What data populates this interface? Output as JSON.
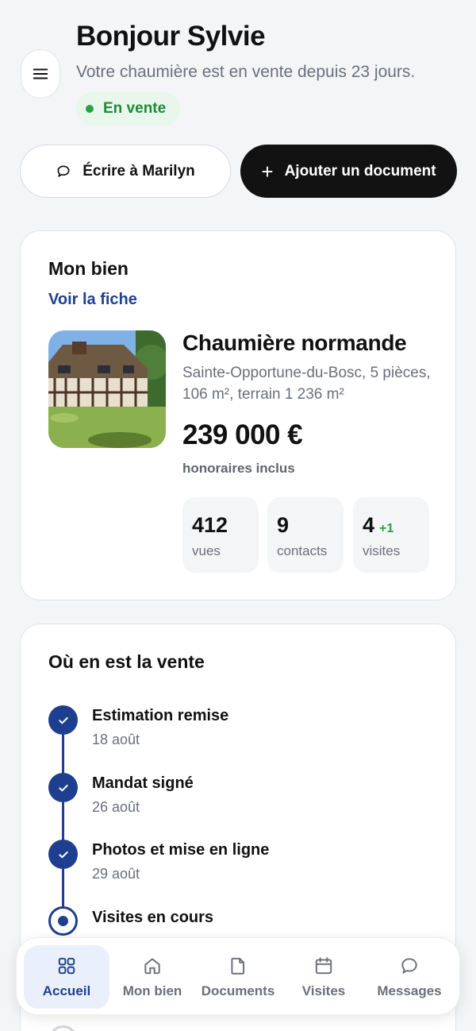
{
  "header": {
    "title": "Bonjour Sylvie",
    "subtitle": "Votre chaumière est en vente depuis 23 jours.",
    "status": "En vente",
    "status_color": "#22a447"
  },
  "actions": {
    "write_label": "Écrire à Marilyn",
    "add_label": "Ajouter un document"
  },
  "property": {
    "section_title": "Mon bien",
    "link": "Voir la fiche",
    "name": "Chaumière normande",
    "description": "Sainte-Opportune-du-Bosc, 5 pièces, 106 m², terrain 1 236 m²",
    "price": "239 000 €",
    "fee_note": "honoraires inclus",
    "stats": [
      {
        "value": "412",
        "label": "vues",
        "delta": ""
      },
      {
        "value": "9",
        "label": "contacts",
        "delta": ""
      },
      {
        "value": "4",
        "label": "visites",
        "delta": "+1"
      }
    ]
  },
  "progress": {
    "section_title": "Où en est la vente",
    "steps": [
      {
        "label": "Estimation remise",
        "date": "18 août",
        "state": "done"
      },
      {
        "label": "Mandat signé",
        "date": "26 août",
        "state": "done"
      },
      {
        "label": "Photos et mise en ligne",
        "date": "29 août",
        "state": "done"
      },
      {
        "label": "Visites en cours",
        "date": "",
        "state": "current"
      }
    ]
  },
  "tabbar": {
    "items": [
      {
        "label": "Accueil",
        "icon": "grid-icon",
        "active": true
      },
      {
        "label": "Mon bien",
        "icon": "home-icon",
        "active": false
      },
      {
        "label": "Documents",
        "icon": "document-icon",
        "active": false
      },
      {
        "label": "Visites",
        "icon": "calendar-icon",
        "active": false
      },
      {
        "label": "Messages",
        "icon": "chat-icon",
        "active": false
      }
    ]
  },
  "colors": {
    "accent": "#1e3f8f",
    "background": "#f4f5f7",
    "primary_button": "#121212"
  }
}
